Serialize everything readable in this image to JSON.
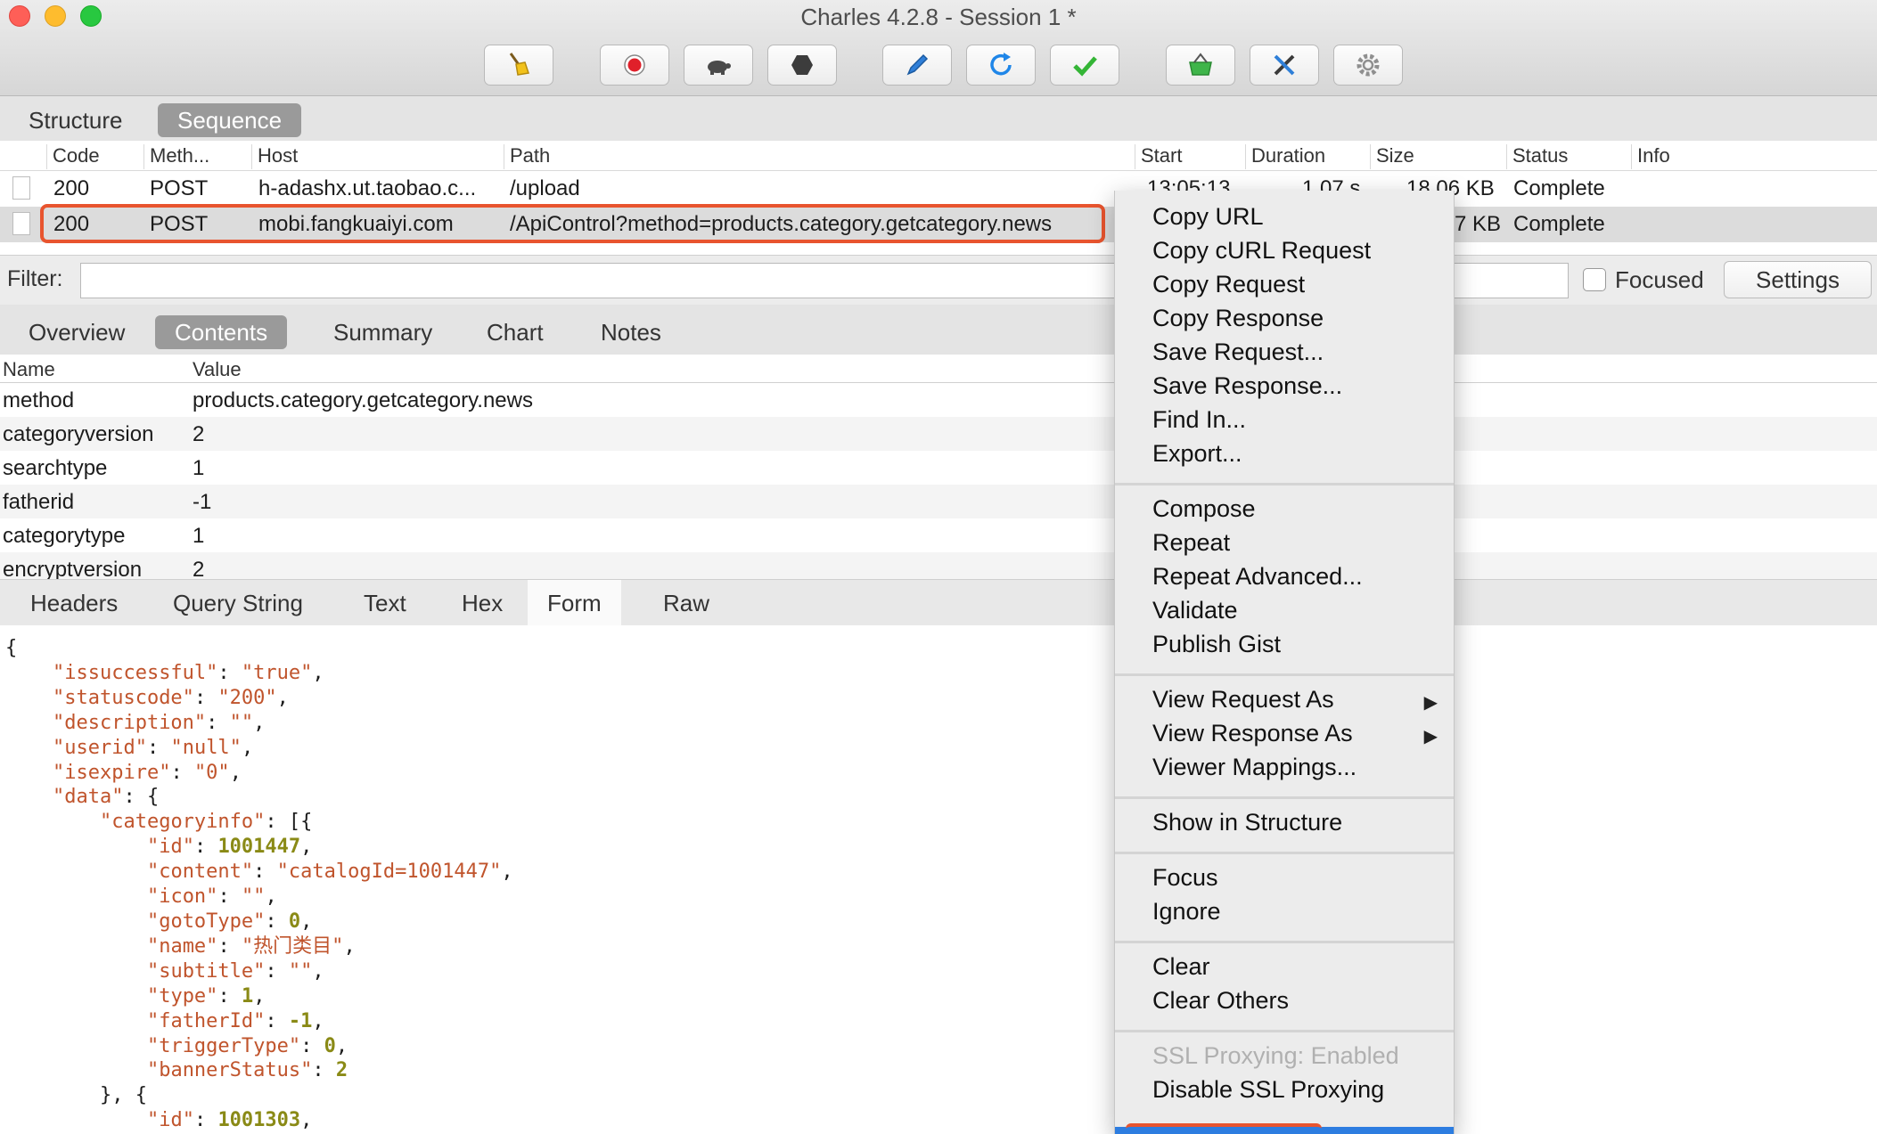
{
  "window": {
    "title": "Charles 4.2.8 - Session 1 *"
  },
  "toolbar": {
    "buttons": [
      {
        "name": "broom-icon"
      },
      {
        "name": "record-icon"
      },
      {
        "name": "throttle-turtle-icon"
      },
      {
        "name": "breakpoint-hexagon-icon"
      },
      {
        "name": "compose-pen-icon"
      },
      {
        "name": "repeat-refresh-icon"
      },
      {
        "name": "validate-check-icon"
      },
      {
        "name": "basket-icon"
      },
      {
        "name": "tools-icon"
      },
      {
        "name": "settings-gear-icon"
      }
    ]
  },
  "view_tabs": {
    "structure": "Structure",
    "sequence": "Sequence"
  },
  "requests": {
    "columns": [
      "Code",
      "Meth...",
      "Host",
      "Path",
      "Start",
      "Duration",
      "Size",
      "Status",
      "Info"
    ],
    "rows": [
      {
        "code": "200",
        "method": "POST",
        "host": "h-adashx.ut.taobao.c...",
        "path": "/upload",
        "start": "13:05:13",
        "duration": "1.07 s",
        "size": "18.06 KB",
        "status": "Complete"
      },
      {
        "code": "200",
        "method": "POST",
        "host": "mobi.fangkuaiyi.com",
        "path": "/ApiControl?method=products.category.getcategory.news",
        "size_fragment": "7 KB",
        "status": "Complete"
      }
    ]
  },
  "filter": {
    "label": "Filter:",
    "focused_label": "Focused",
    "settings_label": "Settings"
  },
  "detail_tabs": [
    "Overview",
    "Contents",
    "Summary",
    "Chart",
    "Notes"
  ],
  "params": {
    "name_header": "Name",
    "value_header": "Value",
    "rows": [
      {
        "name": "method",
        "value": "products.category.getcategory.news"
      },
      {
        "name": "categoryversion",
        "value": "2"
      },
      {
        "name": "searchtype",
        "value": "1"
      },
      {
        "name": "fatherid",
        "value": "-1"
      },
      {
        "name": "categorytype",
        "value": "1"
      },
      {
        "name": "encryptversion",
        "value": "2"
      }
    ]
  },
  "body_tabs": [
    "Headers",
    "Query String",
    "Text",
    "Hex",
    "Form",
    "Raw"
  ],
  "json_lines": [
    {
      "text": "{"
    },
    {
      "text": "    \"issuccessful\": \"true\","
    },
    {
      "text": "    \"statuscode\": \"200\","
    },
    {
      "text": "    \"description\": \"\","
    },
    {
      "text": "    \"userid\": \"null\","
    },
    {
      "text": "    \"isexpire\": \"0\","
    },
    {
      "text": "    \"data\": {"
    },
    {
      "text": "        \"categoryinfo\": [{"
    },
    {
      "text": "            \"id\": 1001447,"
    },
    {
      "text": "            \"content\": \"catalogId=1001447\","
    },
    {
      "text": "            \"icon\": \"\","
    },
    {
      "text": "            \"gotoType\": 0,"
    },
    {
      "text": "            \"name\": \"热门类目\","
    },
    {
      "text": "            \"subtitle\": \"\","
    },
    {
      "text": "            \"type\": 1,"
    },
    {
      "text": "            \"fatherId\": -1,"
    },
    {
      "text": "            \"triggerType\": 0,"
    },
    {
      "text": "            \"bannerStatus\": 2"
    },
    {
      "text": "        }, {"
    },
    {
      "text": "            \"id\": 1001303,"
    }
  ],
  "context_menu": {
    "groups": [
      [
        "Copy URL",
        "Copy cURL Request",
        "Copy Request",
        "Copy Response",
        "Save Request...",
        "Save Response...",
        "Find In...",
        "Export..."
      ],
      [
        "Compose",
        "Repeat",
        "Repeat Advanced...",
        "Validate",
        "Publish Gist"
      ],
      [
        "View Request As",
        "View Response As",
        "Viewer Mappings..."
      ],
      [
        "Show in Structure"
      ],
      [
        "Focus",
        "Ignore"
      ],
      [
        "Clear",
        "Clear Others"
      ],
      [
        "SSL Proxying: Enabled",
        "Disable SSL Proxying"
      ]
    ],
    "submenu_marker": "▶"
  }
}
